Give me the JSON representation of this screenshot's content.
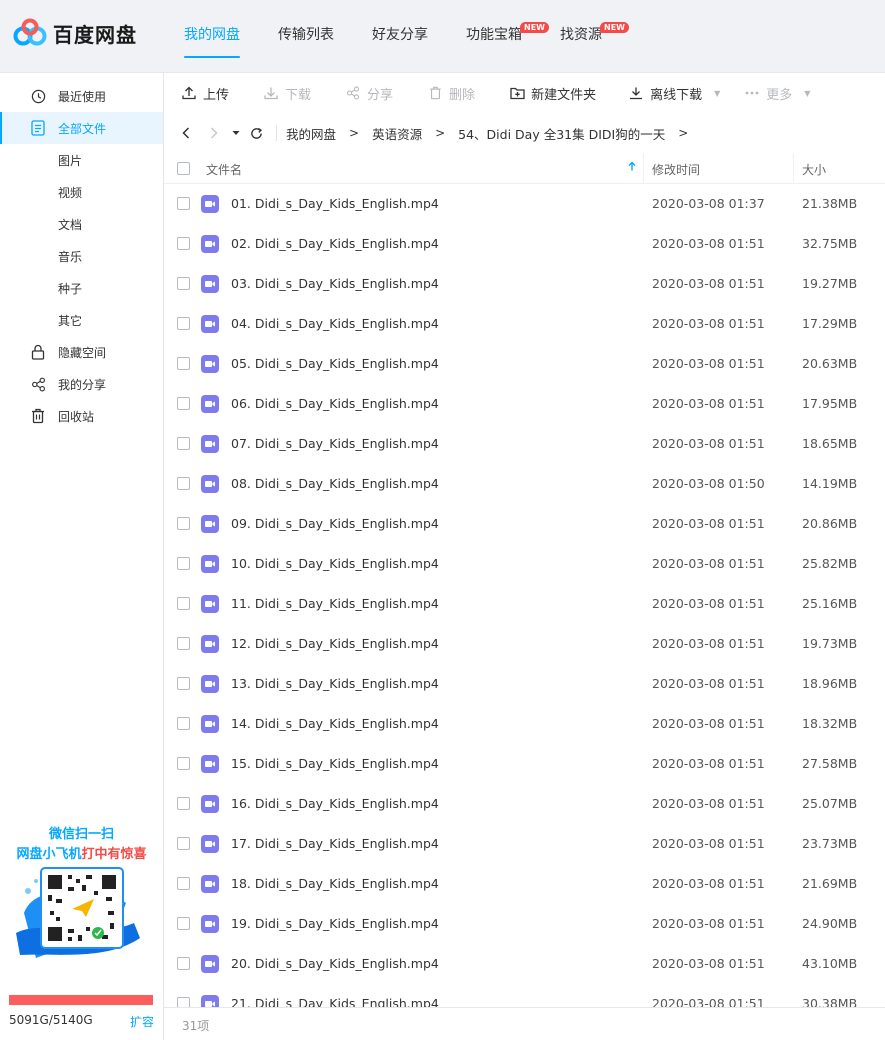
{
  "app": {
    "logo_text": "百度网盘"
  },
  "topnav": [
    {
      "label": "我的网盘",
      "active": true,
      "badge": ""
    },
    {
      "label": "传输列表",
      "active": false,
      "badge": ""
    },
    {
      "label": "好友分享",
      "active": false,
      "badge": ""
    },
    {
      "label": "功能宝箱",
      "active": false,
      "badge": "NEW"
    },
    {
      "label": "找资源",
      "active": false,
      "badge": "NEW"
    }
  ],
  "sidebar": {
    "items": [
      {
        "label": "最近使用",
        "icon": "clock-icon",
        "type": "main"
      },
      {
        "label": "全部文件",
        "icon": "document-icon",
        "type": "main",
        "active": true
      },
      {
        "label": "图片",
        "type": "sub"
      },
      {
        "label": "视频",
        "type": "sub"
      },
      {
        "label": "文档",
        "type": "sub"
      },
      {
        "label": "音乐",
        "type": "sub"
      },
      {
        "label": "种子",
        "type": "sub"
      },
      {
        "label": "其它",
        "type": "sub"
      },
      {
        "label": "隐藏空间",
        "icon": "lock-icon",
        "type": "main"
      },
      {
        "label": "我的分享",
        "icon": "share-icon",
        "type": "main"
      },
      {
        "label": "回收站",
        "icon": "trash-icon",
        "type": "main"
      }
    ],
    "promo": {
      "line1": "微信扫一扫",
      "line2_a": "网盘小飞机",
      "line2_b": "打中有惊喜"
    },
    "quota": {
      "used_ratio": 0.99,
      "text": "5091G/5140G",
      "expand_label": "扩容"
    }
  },
  "toolbar": {
    "upload": "上传",
    "download": "下载",
    "share": "分享",
    "delete": "删除",
    "new_folder": "新建文件夹",
    "offline_download": "离线下载",
    "more": "更多"
  },
  "breadcrumb": [
    "我的网盘",
    "英语资源",
    "54、Didi Day 全31集 DIDI狗的一天"
  ],
  "table": {
    "headers": {
      "name": "文件名",
      "modified": "修改时间",
      "size": "大小"
    },
    "rows": [
      {
        "name": "01. Didi_s_Day_Kids_English.mp4",
        "time": "2020-03-08 01:37",
        "size": "21.38MB"
      },
      {
        "name": "02. Didi_s_Day_Kids_English.mp4",
        "time": "2020-03-08 01:51",
        "size": "32.75MB"
      },
      {
        "name": "03. Didi_s_Day_Kids_English.mp4",
        "time": "2020-03-08 01:51",
        "size": "19.27MB"
      },
      {
        "name": "04. Didi_s_Day_Kids_English.mp4",
        "time": "2020-03-08 01:51",
        "size": "17.29MB"
      },
      {
        "name": "05. Didi_s_Day_Kids_English.mp4",
        "time": "2020-03-08 01:51",
        "size": "20.63MB"
      },
      {
        "name": "06. Didi_s_Day_Kids_English.mp4",
        "time": "2020-03-08 01:51",
        "size": "17.95MB"
      },
      {
        "name": "07. Didi_s_Day_Kids_English.mp4",
        "time": "2020-03-08 01:51",
        "size": "18.65MB"
      },
      {
        "name": "08. Didi_s_Day_Kids_English.mp4",
        "time": "2020-03-08 01:50",
        "size": "14.19MB"
      },
      {
        "name": "09. Didi_s_Day_Kids_English.mp4",
        "time": "2020-03-08 01:51",
        "size": "20.86MB"
      },
      {
        "name": "10. Didi_s_Day_Kids_English.mp4",
        "time": "2020-03-08 01:51",
        "size": "25.82MB"
      },
      {
        "name": "11. Didi_s_Day_Kids_English.mp4",
        "time": "2020-03-08 01:51",
        "size": "25.16MB"
      },
      {
        "name": "12. Didi_s_Day_Kids_English.mp4",
        "time": "2020-03-08 01:51",
        "size": "19.73MB"
      },
      {
        "name": "13. Didi_s_Day_Kids_English.mp4",
        "time": "2020-03-08 01:51",
        "size": "18.96MB"
      },
      {
        "name": "14. Didi_s_Day_Kids_English.mp4",
        "time": "2020-03-08 01:51",
        "size": "18.32MB"
      },
      {
        "name": "15. Didi_s_Day_Kids_English.mp4",
        "time": "2020-03-08 01:51",
        "size": "27.58MB"
      },
      {
        "name": "16. Didi_s_Day_Kids_English.mp4",
        "time": "2020-03-08 01:51",
        "size": "25.07MB"
      },
      {
        "name": "17. Didi_s_Day_Kids_English.mp4",
        "time": "2020-03-08 01:51",
        "size": "23.73MB"
      },
      {
        "name": "18. Didi_s_Day_Kids_English.mp4",
        "time": "2020-03-08 01:51",
        "size": "21.69MB"
      },
      {
        "name": "19. Didi_s_Day_Kids_English.mp4",
        "time": "2020-03-08 01:51",
        "size": "24.90MB"
      },
      {
        "name": "20. Didi_s_Day_Kids_English.mp4",
        "time": "2020-03-08 01:51",
        "size": "43.10MB"
      },
      {
        "name": "21. Didi_s_Day_Kids_English.mp4",
        "time": "2020-03-08 01:51",
        "size": "30.38MB"
      }
    ]
  },
  "footer": {
    "count_text": "31项"
  },
  "colors": {
    "accent": "#06a7ff",
    "badge": "#f54a45",
    "video_icon": "#7d7bef",
    "quota_bar": "#fb5c5c"
  }
}
